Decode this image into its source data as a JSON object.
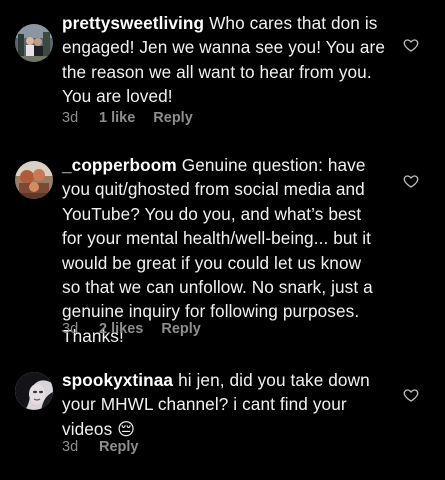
{
  "comments": [
    {
      "username": "prettysweetliving",
      "lines": [
        "Who cares that don is",
        "engaged! Jen we wanna see you! You are",
        "the reason we all want to hear from you.",
        "You are loved!"
      ],
      "timestamp": "3d",
      "likes": "1 like",
      "reply": "Reply",
      "avatar_icon": "avatar-photo-icon",
      "heart_icon": "heart-outline-icon"
    },
    {
      "username": "_copperboom",
      "lines": [
        "Genuine question: have",
        "you quit/ghosted from social media and",
        "YouTube? You do you, and what’s best",
        "for your mental health/well-being... but it",
        "would be great if you could let us know",
        "so that we can unfollow. No snark, just a",
        "genuine inquiry for following purposes.",
        "Thanks!"
      ],
      "timestamp": "3d",
      "likes": "2 likes",
      "reply": "Reply",
      "avatar_icon": "avatar-photo-icon",
      "heart_icon": "heart-outline-icon"
    },
    {
      "username": "spookyxtinaa",
      "lines": [
        "hi jen, did you take down",
        "your MHWL channel? i cant find your",
        "videos 😔"
      ],
      "timestamp": "3d",
      "likes": "",
      "reply": "Reply",
      "avatar_icon": "avatar-photo-icon",
      "heart_icon": "heart-outline-icon"
    }
  ],
  "colors": {
    "background": "#000000",
    "text": "#f2f2f2",
    "meta": "#8e8e8e"
  }
}
